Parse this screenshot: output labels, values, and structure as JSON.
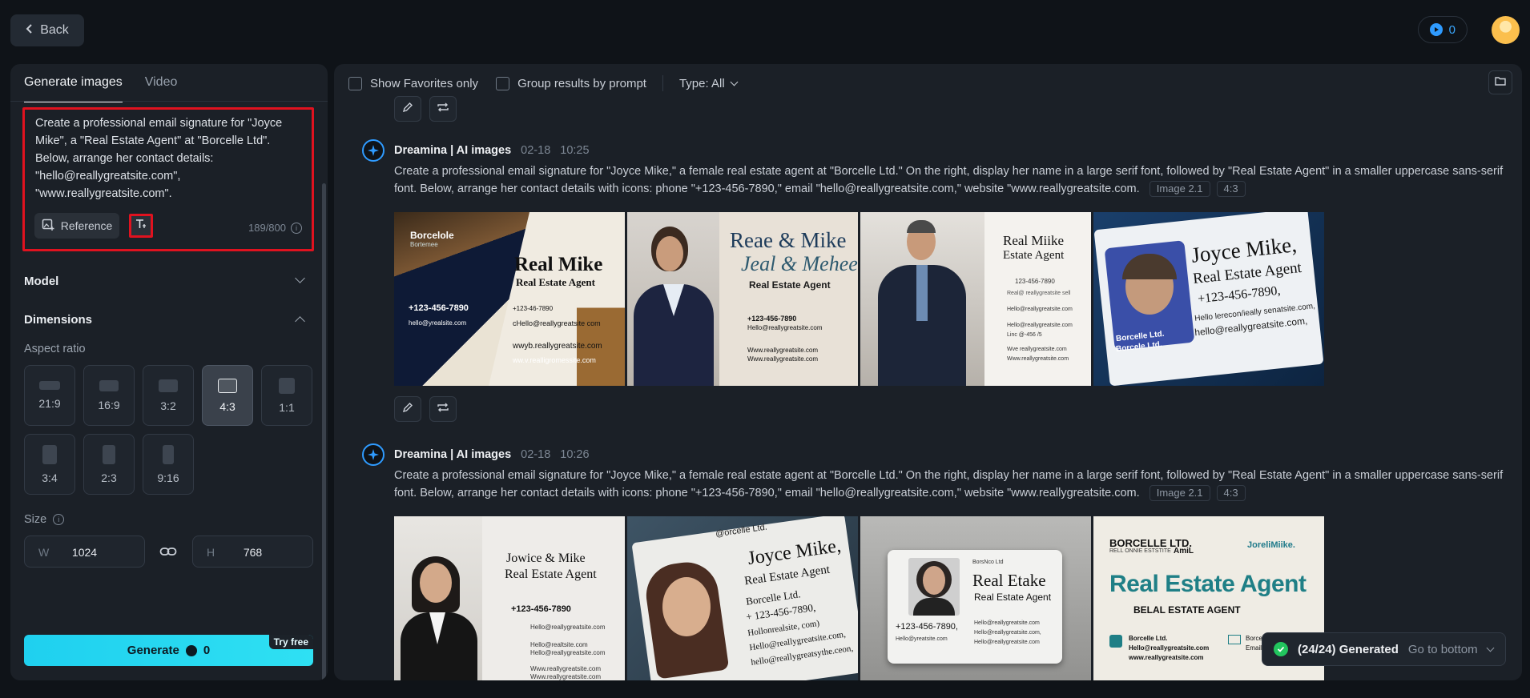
{
  "header": {
    "back_label": "Back",
    "credits": "0"
  },
  "left": {
    "tabs": [
      "Generate images",
      "Video"
    ],
    "prompt": "Create a professional email signature for \"Joyce Mike\", a \"Real Estate Agent\" at \"Borcelle Ltd\". Below, arrange her contact details: \"hello@reallygreatsite.com\", \"www.reallygreatsite.com\".",
    "reference_label": "Reference",
    "counter": "189/800",
    "model_label": "Model",
    "dimensions_label": "Dimensions",
    "aspect_label": "Aspect ratio",
    "ratios": [
      "21:9",
      "16:9",
      "3:2",
      "4:3",
      "1:1",
      "3:4",
      "2:3",
      "9:16"
    ],
    "selected_ratio": "4:3",
    "size_label": "Size",
    "width_label": "W",
    "width": "1024",
    "height_label": "H",
    "height": "768",
    "generate_label": "Generate",
    "generate_cost": "0",
    "try_free": "Try free"
  },
  "right": {
    "show_favorites": "Show Favorites only",
    "group_results": "Group results by prompt",
    "type_filter": "Type: All",
    "generations": [
      {
        "author": "Dreamina | AI images",
        "date": "02-18",
        "time": "10:25",
        "prompt": "Create a professional email signature for \"Joyce Mike,\" a female real estate agent at \"Borcelle Ltd.\" On the right, display her name in a large serif font, followed by \"Real Estate Agent\" in a smaller uppercase sans-serif font. Below, arrange her contact details with icons: phone \"+123-456-7890,\" email \"hello@reallygreatsite.com,\" website \"www.reallygreatsite.com.",
        "model_tag": "Image 2.1",
        "ratio_tag": "4:3",
        "cards": [
          {
            "brand": "Borcelole",
            "sub": "Bortemee",
            "name": "Real Mike",
            "title": "Real Estate Agent",
            "phone": "+123-456-7890",
            "email": "hello@yrealsite.com",
            "email2": "cHello@reallygreatsite com",
            "web": "wwyb.reallygreatsite.com",
            "web2": "ww.v.realligromessite.com",
            "phone2": "+123-46-7890"
          },
          {
            "name": "Reae & Mike",
            "script": "Jeal & Mehee",
            "title": "Real Estate Agent",
            "phone": "+123-456-7890",
            "email": "Hello@reallygreatsite.com",
            "web": "Www.reallygreatsite.com",
            "web2": "Www.reallygreatsite.com"
          },
          {
            "name": "Real Miike",
            "title": "Estate Agent",
            "phone": "123-456-7890",
            "line1": "Real@ reallygreatsite sell",
            "line2": "Hello@reallygreatsite.com",
            "line3": "Hello@reallygreatsite.com",
            "line4": "Linc @-456 /5",
            "line5": "Wve reallygreatsite.com",
            "line6": "Www.reallygreatsite.com"
          },
          {
            "name": "Joyce Mike,",
            "title": "Real Estate Agent",
            "phone": "+123-456-7890,",
            "l1": "Hello lerecon/ieally senatsite.com,",
            "l2": "hello@reallygreatsite.com,",
            "company": "Borcelle Ltd.",
            "company2": "Borcele Ltd."
          }
        ]
      },
      {
        "author": "Dreamina | AI images",
        "date": "02-18",
        "time": "10:26",
        "prompt": "Create a professional email signature for \"Joyce Mike,\" a female real estate agent at \"Borcelle Ltd.\" On the right, display her name in a large serif font, followed by \"Real Estate Agent\" in a smaller uppercase sans-serif font. Below, arrange her contact details with icons: phone \"+123-456-7890,\" email \"hello@reallygreatsite.com,\" website \"www.reallygreatsite.com.",
        "model_tag": "Image 2.1",
        "ratio_tag": "4:3",
        "cards": [
          {
            "name": "Jowice & Mike",
            "title": "Real Estate Agent",
            "phone": "+123-456-7890",
            "email": "Hello@reallygreatsite.com",
            "l1": "Hello@realtsite.com",
            "l2": "Hello@reallygreatsite.com",
            "l3": "Www.reallygreatsite.com",
            "l4": "Www.reallygreatsite.com"
          },
          {
            "brand": "@orcelle Ltd.",
            "name": "Joyce Mike,",
            "title": "Real Estate Agent",
            "company": "Borcelle Ltd.",
            "phone": "+ 123-456-7890,",
            "l1": "Hollonrealsite, com)",
            "l2": "Hello@reallygreatsite.com,",
            "l3": "hello@reallygreatsythe.ceon,"
          },
          {
            "top": "BorsNco Ltd",
            "name": "Real Etake",
            "title": "Real Estate Agent",
            "phone": "+123-456-7890,",
            "l1": "Hello@reallygreatsite.com",
            "l2": "Hello@reallygreatsite.com,",
            "l3": "Hello@reallygreatsite.com",
            "l4": "Hello@yreatsite.com"
          },
          {
            "brand": "BORCELLE LTD.",
            "brand2": "AmiL",
            "brand_sub": "RELL ONNIE ESTSTITE",
            "right_brand": "JoreliMiike.",
            "title": "Real Estate Agent",
            "sub": "BELAL ESTATE AGENT",
            "l1": "Borcelle Ltd.",
            "l2": "Hello@reallygreatsite.com",
            "l3": "www.reallygreatsite.com",
            "r1": "Borcelle Ltd.",
            "r2": "Email Borcelle,"
          }
        ]
      }
    ]
  },
  "toast": {
    "status": "(24/24) Generated",
    "action": "Go to bottom"
  },
  "colors": {
    "accent": "#2fe0f3",
    "highlight": "#e0121f",
    "success": "#22c55e"
  }
}
